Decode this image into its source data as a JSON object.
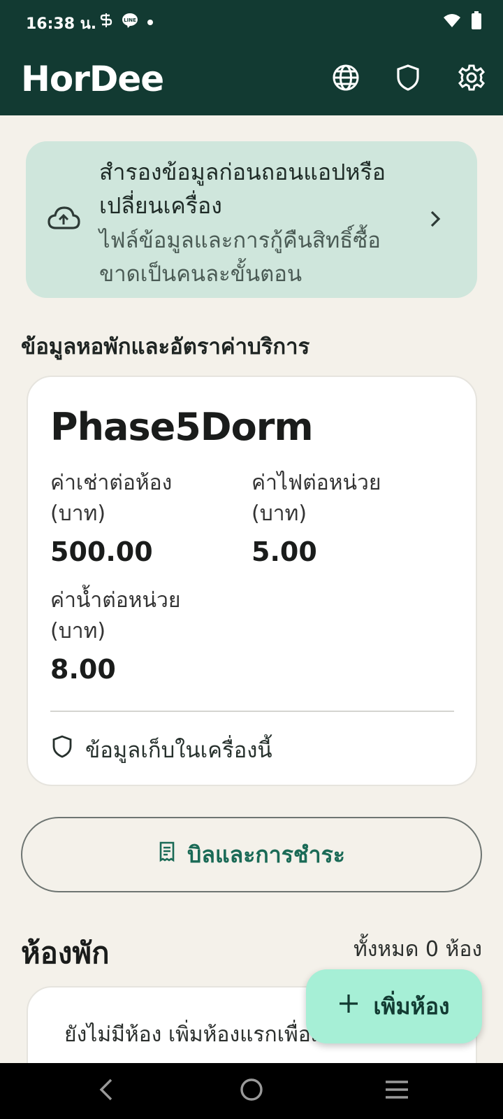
{
  "status_bar": {
    "time": "16:38 น.",
    "icons": [
      "s-app-icon",
      "line-app-icon",
      "dot-icon",
      "wifi-icon",
      "battery-icon"
    ]
  },
  "app_bar": {
    "title": "HorDee",
    "actions": [
      "globe-icon",
      "shield-icon",
      "gear-icon"
    ]
  },
  "backup_banner": {
    "title": "สำรองข้อมูลก่อนถอนแอปหรือเปลี่ยนเครื่อง",
    "subtitle": "ไฟล์ข้อมูลและการกู้คืนสิทธิ์ซื้อขาดเป็นคนละขั้นตอน"
  },
  "section_title": "ข้อมูลหอพักและอัตราค่าบริการ",
  "dorm": {
    "name": "Phase5Dorm",
    "rates": [
      {
        "label": "ค่าเช่าต่อห้อง (บาท)",
        "value": "500.00"
      },
      {
        "label": "ค่าไฟต่อหน่วย (บาท)",
        "value": "5.00"
      },
      {
        "label": "ค่าน้ำต่อหน่วย (บาท)",
        "value": "8.00"
      }
    ],
    "storage_note": "ข้อมูลเก็บในเครื่องนี้"
  },
  "bills_button": "บิลและการชำระ",
  "rooms": {
    "title": "ห้องพัก",
    "count_label": "ทั้งหมด 0 ห้อง",
    "empty_message": "ยังไม่มีห้อง เพิ่มห้องแรกเพื่อเริ่มต้นใช้งาน"
  },
  "fab_label": "เพิ่มห้อง",
  "colors": {
    "primary_dark": "#123a32",
    "banner_bg": "#cfe6dc",
    "accent_text": "#1a6a56",
    "fab_bg": "#a6efd6",
    "page_bg": "#f4f1ea"
  }
}
